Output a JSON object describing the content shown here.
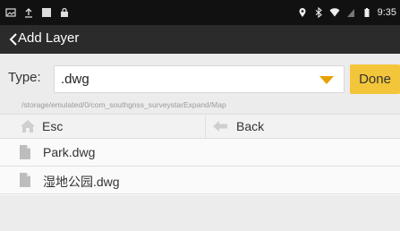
{
  "status_bar": {
    "time": "9:35",
    "left_icons": [
      "image-icon",
      "upload-icon",
      "square-icon",
      "lock-icon"
    ],
    "right_icons": [
      "location-icon",
      "bluetooth-icon",
      "wifi-icon",
      "sim-icon",
      "battery-icon"
    ]
  },
  "header": {
    "title": "Add Layer",
    "back_icon": "chevron-left-icon"
  },
  "type_selector": {
    "label": "Type:",
    "value": ".dwg",
    "done_label": "Done"
  },
  "current_path": "/storage/emulated/0/com_southgnss_surveystarExpand/Map",
  "navigation": {
    "esc_label": "Esc",
    "back_label": "Back"
  },
  "files": [
    {
      "name": "Park.dwg"
    },
    {
      "name": "湿地公园.dwg"
    }
  ],
  "colors": {
    "status_bar": "#111111",
    "title_bar": "#2b2b2b",
    "accent": "#f3c53a",
    "caret": "#e8a200",
    "background": "#ececec"
  }
}
